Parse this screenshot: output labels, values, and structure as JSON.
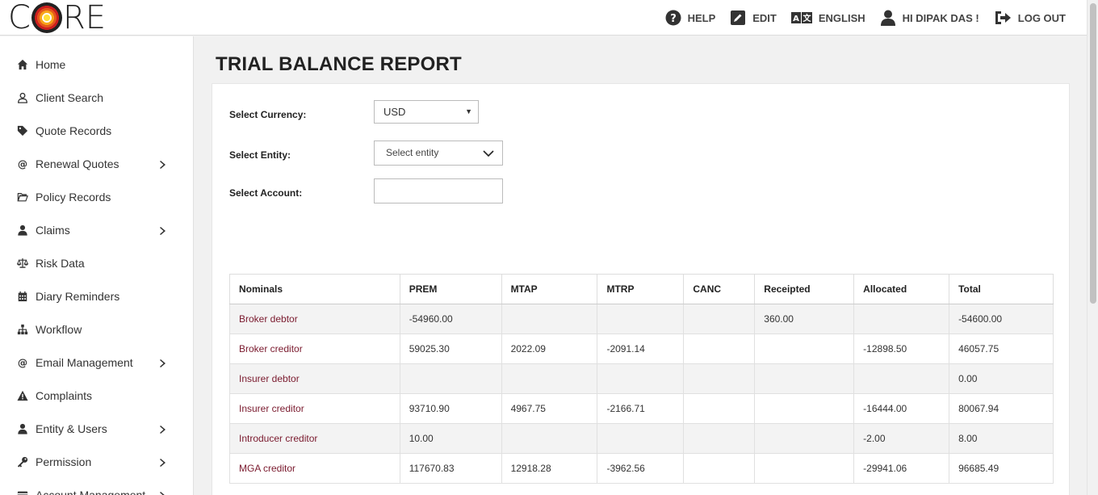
{
  "app": {
    "logo_letters": [
      "C",
      "RE"
    ]
  },
  "topnav": {
    "help": "HELP",
    "edit": "EDIT",
    "language": "ENGLISH",
    "user": "HI DIPAK DAS !",
    "logout": "LOG OUT"
  },
  "sidebar": {
    "items": [
      {
        "label": "Home",
        "icon": "home-icon",
        "has_submenu": false
      },
      {
        "label": "Client Search",
        "icon": "user-outline-icon",
        "has_submenu": false
      },
      {
        "label": "Quote Records",
        "icon": "tag-icon",
        "has_submenu": false
      },
      {
        "label": "Renewal Quotes",
        "icon": "at-icon",
        "has_submenu": true
      },
      {
        "label": "Policy Records",
        "icon": "folder-open-icon",
        "has_submenu": false
      },
      {
        "label": "Claims",
        "icon": "user-icon",
        "has_submenu": true
      },
      {
        "label": "Risk Data",
        "icon": "balance-scale-icon",
        "has_submenu": false
      },
      {
        "label": "Diary Reminders",
        "icon": "calendar-icon",
        "has_submenu": false
      },
      {
        "label": "Workflow",
        "icon": "sitemap-icon",
        "has_submenu": false
      },
      {
        "label": "Email Management",
        "icon": "at-icon",
        "has_submenu": true
      },
      {
        "label": "Complaints",
        "icon": "warning-icon",
        "has_submenu": false
      },
      {
        "label": "Entity & Users",
        "icon": "user-icon",
        "has_submenu": true
      },
      {
        "label": "Permission",
        "icon": "key-icon",
        "has_submenu": true
      },
      {
        "label": "Account Management",
        "icon": "credit-card-icon",
        "has_submenu": true
      }
    ]
  },
  "main": {
    "title": "TRIAL BALANCE REPORT",
    "form": {
      "currency_label": "Select Currency:",
      "currency_value": "USD",
      "entity_label": "Select Entity:",
      "entity_placeholder": "Select entity",
      "account_label": "Select Account:",
      "account_value": ""
    },
    "table": {
      "headers": [
        "Nominals",
        "PREM",
        "MTAP",
        "MTRP",
        "CANC",
        "Receipted",
        "Allocated",
        "Total"
      ],
      "rows": [
        [
          "Broker debtor",
          "-54960.00",
          "",
          "",
          "",
          "360.00",
          "",
          "-54600.00"
        ],
        [
          "Broker creditor",
          "59025.30",
          "2022.09",
          "-2091.14",
          "",
          "",
          "-12898.50",
          "46057.75"
        ],
        [
          "Insurer debtor",
          "",
          "",
          "",
          "",
          "",
          "",
          "0.00"
        ],
        [
          "Insurer creditor",
          "93710.90",
          "4967.75",
          "-2166.71",
          "",
          "",
          "-16444.00",
          "80067.94"
        ],
        [
          "Introducer creditor",
          "10.00",
          "",
          "",
          "",
          "",
          "-2.00",
          "8.00"
        ],
        [
          "MGA creditor",
          "117670.83",
          "12918.28",
          "-3962.56",
          "",
          "",
          "-29941.06",
          "96685.49"
        ]
      ]
    }
  }
}
